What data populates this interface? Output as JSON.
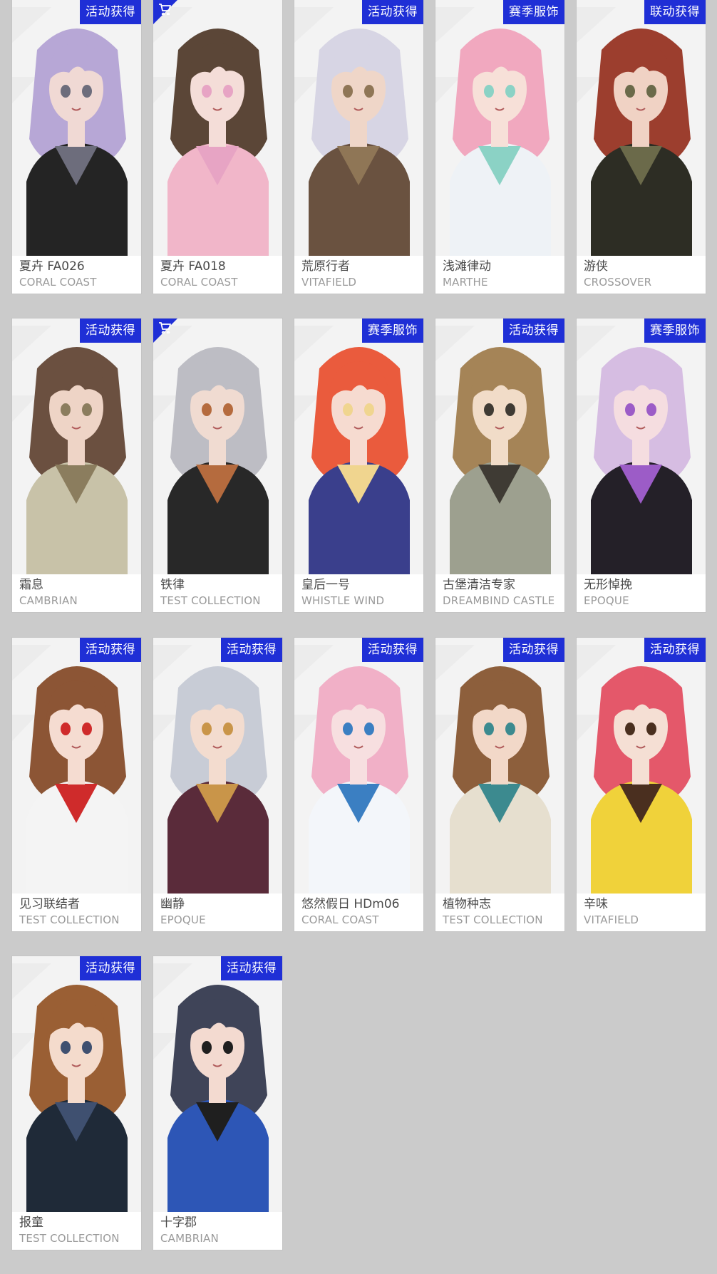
{
  "cards": [
    {
      "name": "夏卉 FA026",
      "brand": "CORAL COAST",
      "badge": "活动获得",
      "shop_icon": false,
      "hair": "#b7a7d6",
      "outfit": "#242424",
      "skin": "#f0d9d4",
      "accent": "#6d6d7c"
    },
    {
      "name": "夏卉 FA018",
      "brand": "CORAL COAST",
      "badge": "",
      "shop_icon": true,
      "hair": "#5b4637",
      "outfit": "#f1b6c9",
      "skin": "#f4ddd8",
      "accent": "#e7a4c4"
    },
    {
      "name": "荒原行者",
      "brand": "VITAFIELD",
      "badge": "活动获得",
      "shop_icon": false,
      "hair": "#d7d5e4",
      "outfit": "#6a5240",
      "skin": "#efd6c8",
      "accent": "#8f7656"
    },
    {
      "name": "浅滩律动",
      "brand": "MARTHE",
      "badge": "赛季服饰",
      "shop_icon": false,
      "hair": "#f1a8bf",
      "outfit": "#eef2f6",
      "skin": "#f7e0d8",
      "accent": "#8bd2c5"
    },
    {
      "name": "游侠",
      "brand": "CROSSOVER",
      "badge": "联动获得",
      "shop_icon": false,
      "hair": "#9c3e2e",
      "outfit": "#2d2d24",
      "skin": "#f0d2c4",
      "accent": "#6b6a4a"
    },
    {
      "name": "霜息",
      "brand": "CAMBRIAN",
      "badge": "活动获得",
      "shop_icon": false,
      "hair": "#6b5040",
      "outfit": "#c8c2a8",
      "skin": "#eed4c6",
      "accent": "#8b7d5e"
    },
    {
      "name": "铁律",
      "brand": "TEST COLLECTION",
      "badge": "",
      "shop_icon": true,
      "hair": "#bdbdc4",
      "outfit": "#282828",
      "skin": "#f0dbd1",
      "accent": "#b56b3e"
    },
    {
      "name": "皇后一号",
      "brand": "WHISTLE WIND",
      "badge": "赛季服饰",
      "shop_icon": false,
      "hair": "#ea5b3d",
      "outfit": "#3a3f8c",
      "skin": "#f6dbd0",
      "accent": "#f0d58f"
    },
    {
      "name": "古堡清洁专家",
      "brand": "DREAMBIND CASTLE",
      "badge": "活动获得",
      "shop_icon": false,
      "hair": "#a58457",
      "outfit": "#9da08f",
      "skin": "#f1dcc8",
      "accent": "#3f3b34"
    },
    {
      "name": "无形悼挽",
      "brand": "EPOQUE",
      "badge": "赛季服饰",
      "shop_icon": false,
      "hair": "#d6bde2",
      "outfit": "#242028",
      "skin": "#f5dde0",
      "accent": "#9c5cc7"
    },
    {
      "name": "见习联结者",
      "brand": "TEST COLLECTION",
      "badge": "活动获得",
      "shop_icon": false,
      "hair": "#8c5535",
      "outfit": "#f4f4f4",
      "skin": "#f5dcd1",
      "accent": "#cf2b2b"
    },
    {
      "name": "幽静",
      "brand": "EPOQUE",
      "badge": "活动获得",
      "shop_icon": false,
      "hair": "#c8ccd6",
      "outfit": "#5a2b3a",
      "skin": "#f3dccf",
      "accent": "#c99549"
    },
    {
      "name": "悠然假日 HDm06",
      "brand": "CORAL COAST",
      "badge": "活动获得",
      "shop_icon": false,
      "hair": "#f1b0c7",
      "outfit": "#f3f6fa",
      "skin": "#f7dfe0",
      "accent": "#3b7fc2"
    },
    {
      "name": "植物种志",
      "brand": "TEST COLLECTION",
      "badge": "活动获得",
      "shop_icon": false,
      "hair": "#8d5f3c",
      "outfit": "#e6dfcf",
      "skin": "#f2d8c8",
      "accent": "#3c8a8f"
    },
    {
      "name": "辛味",
      "brand": "VITAFIELD",
      "badge": "活动获得",
      "shop_icon": false,
      "hair": "#e4586a",
      "outfit": "#f0d23a",
      "skin": "#f5dfd4",
      "accent": "#4a2f1f"
    },
    {
      "name": "报童",
      "brand": "TEST COLLECTION",
      "badge": "活动获得",
      "shop_icon": false,
      "hair": "#9a5f34",
      "outfit": "#1f2a38",
      "skin": "#f4dbcc",
      "accent": "#3f5070"
    },
    {
      "name": "十字郡",
      "brand": "CAMBRIAN",
      "badge": "活动获得",
      "shop_icon": false,
      "hair": "#3f4458",
      "outfit": "#2d56b6",
      "skin": "#f3dad0",
      "accent": "#1f1f1f"
    }
  ]
}
